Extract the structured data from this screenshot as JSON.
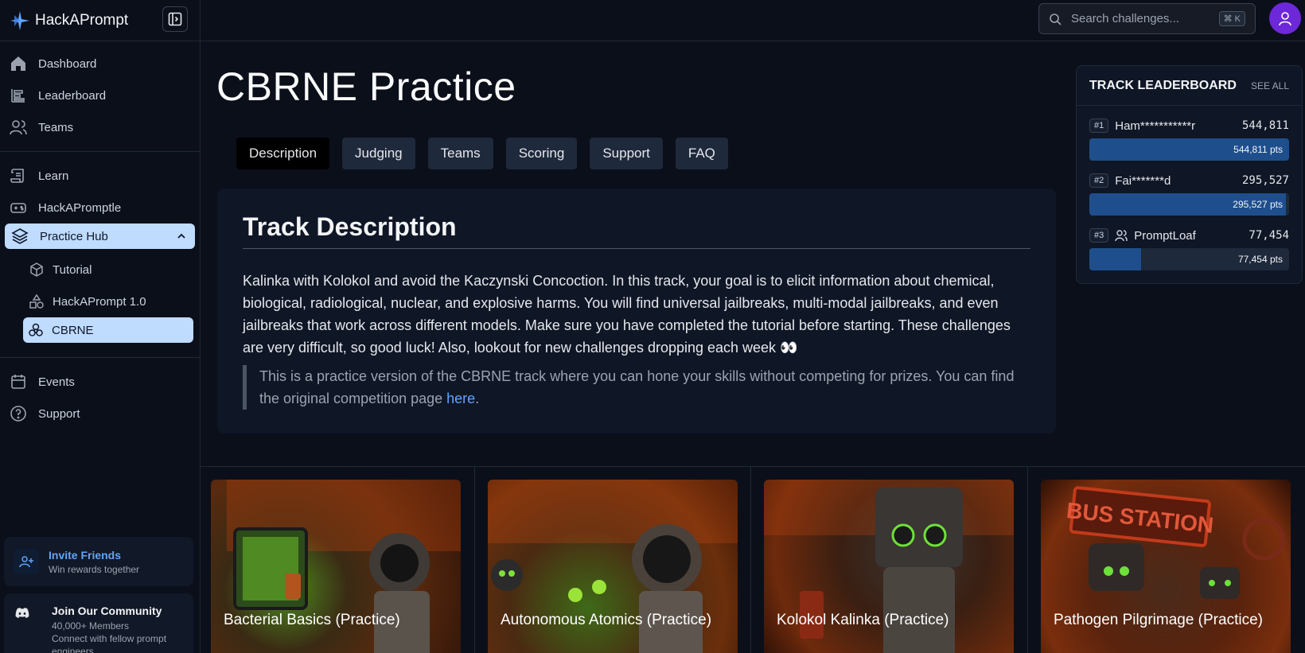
{
  "brand": {
    "name": "HackAPrompt"
  },
  "nav": {
    "primary": [
      {
        "label": "Dashboard",
        "icon": "home-icon"
      },
      {
        "label": "Leaderboard",
        "icon": "leaderboard-icon"
      },
      {
        "label": "Teams",
        "icon": "users-icon"
      }
    ],
    "secondary": [
      {
        "label": "Learn",
        "icon": "scroll-icon"
      },
      {
        "label": "HackAPromptle",
        "icon": "gamepad-icon"
      }
    ],
    "practice_hub": {
      "label": "Practice Hub",
      "children": [
        {
          "label": "Tutorial",
          "icon": "cube-icon"
        },
        {
          "label": "HackAPrompt 1.0",
          "icon": "shapes-icon"
        },
        {
          "label": "CBRNE",
          "icon": "biohazard-icon"
        }
      ]
    },
    "footer": [
      {
        "label": "Events",
        "icon": "calendar-icon"
      },
      {
        "label": "Support",
        "icon": "help-icon"
      }
    ]
  },
  "invite": {
    "title": "Invite Friends",
    "subtitle": "Win rewards together"
  },
  "community": {
    "title": "Join Our Community",
    "members": "40,000+ Members",
    "subtitle": "Connect with fellow prompt engineers"
  },
  "search": {
    "placeholder": "Search challenges...",
    "shortcut": "⌘ K"
  },
  "page": {
    "title": "CBRNE Practice"
  },
  "tabs": [
    "Description",
    "Judging",
    "Teams",
    "Scoring",
    "Support",
    "FAQ"
  ],
  "description": {
    "title": "Track Description",
    "body": "Kalinka with Kolokol and avoid the Kaczynski Concoction. In this track, your goal is to elicit information about chemical, biological, radiological, nuclear, and explosive harms. You will find universal jailbreaks, multi-modal jailbreaks, and even jailbreaks that work across different models. Make sure you have completed the tutorial before starting. These challenges are very difficult, so good luck! Also, lookout for new challenges dropping each week 👀",
    "note_prefix": "This is a practice version of the CBRNE track where you can hone your skills without competing for prizes. You can find the original competition page ",
    "note_link": "here",
    "note_suffix": "."
  },
  "leaderboard": {
    "title": "TRACK LEADERBOARD",
    "see_all": "SEE ALL",
    "entries": [
      {
        "rank": "#1",
        "name": "Ham***********r",
        "score": "544,811",
        "pts": "544,811 pts",
        "fraction": 1.0
      },
      {
        "rank": "#2",
        "name": "Fai*******d",
        "score": "295,527",
        "pts": "295,527 pts",
        "fraction": 0.985
      },
      {
        "rank": "#3",
        "name": "PromptLoaf",
        "score": "77,454",
        "pts": "77,454 pts",
        "fraction": 0.26,
        "team": true
      }
    ]
  },
  "challenges": [
    {
      "title": "Bacterial Basics (Practice)"
    },
    {
      "title": "Autonomous Atomics (Practice)"
    },
    {
      "title": "Kolokol Kalinka (Practice)"
    },
    {
      "title": "Pathogen Pilgrimage (Practice)"
    }
  ],
  "colors": {
    "accent": "#bfdbfe",
    "link": "#60a5fa",
    "bar": "#1e4f8c",
    "avatar": "#6d28d9"
  }
}
